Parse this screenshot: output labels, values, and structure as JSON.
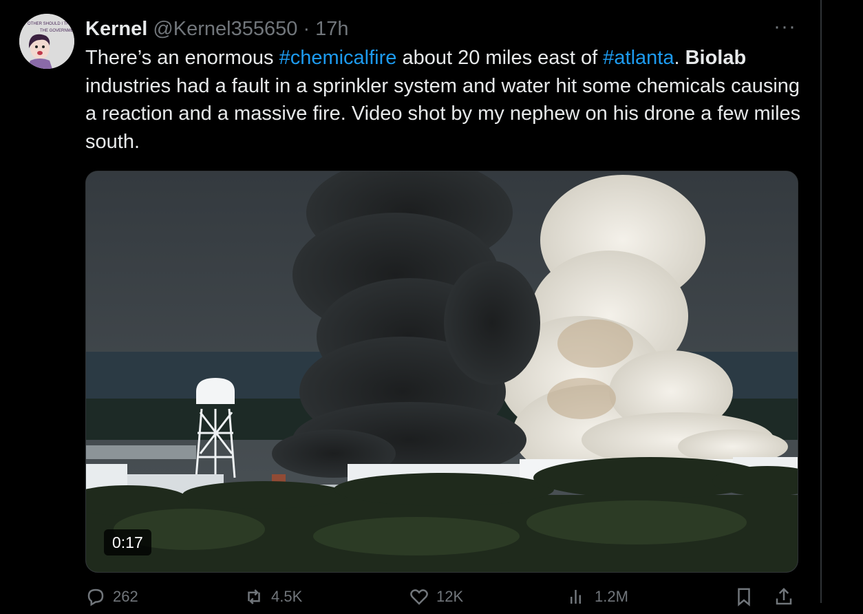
{
  "tweet": {
    "author_name": "Kernel",
    "handle": "@Kernel355650",
    "separator": "·",
    "time": "17h",
    "more": "···",
    "text_before_tag1": "There’s an enormous ",
    "tag1": "#chemicalfire",
    "text_between": " about 20 miles east of ",
    "tag2": "#atlanta",
    "text_dot": ". ",
    "bold_word": "Biolab",
    "text_rest": " industries had a fault in a sprinkler system and water hit some chemicals causing a reaction and a massive fire. Video shot by my nephew on his drone a few miles south.",
    "avatar_text": [
      "OTHER SHOULD I TRU",
      "THE GOVERNME"
    ]
  },
  "media": {
    "duration": "0:17"
  },
  "actions": {
    "replies": "262",
    "retweets": "4.5K",
    "likes": "12K",
    "views": "1.2M"
  },
  "colors": {
    "background": "#000000",
    "text": "#e7e9ea",
    "muted": "#71767b",
    "link": "#1d9bf0"
  },
  "icons": [
    "reply-icon",
    "retweet-icon",
    "like-icon",
    "views-icon",
    "bookmark-icon",
    "share-icon"
  ]
}
